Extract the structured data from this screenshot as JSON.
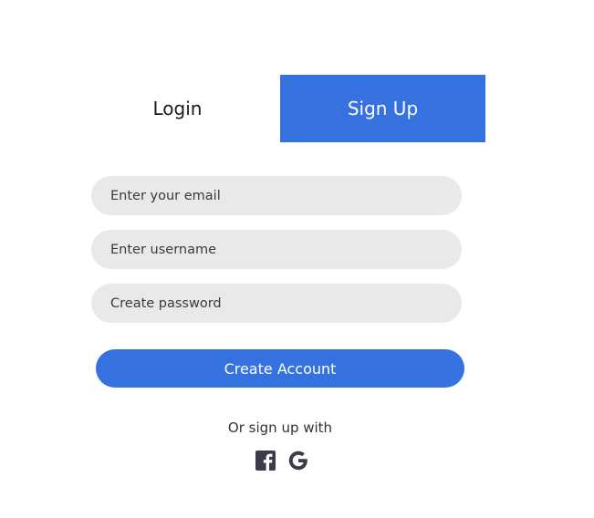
{
  "tabs": {
    "login_label": "Login",
    "signup_label": "Sign Up",
    "active": "signup"
  },
  "form": {
    "email_placeholder": "Enter your email",
    "username_placeholder": "Enter username",
    "password_placeholder": "Create password",
    "submit_label": "Create Account"
  },
  "alt_signup": {
    "text": "Or sign up with",
    "icons": [
      "facebook-icon",
      "google-icon"
    ]
  },
  "colors": {
    "accent": "#3672df",
    "field_bg": "#e9e9e9",
    "icon": "#3b3b4a"
  }
}
